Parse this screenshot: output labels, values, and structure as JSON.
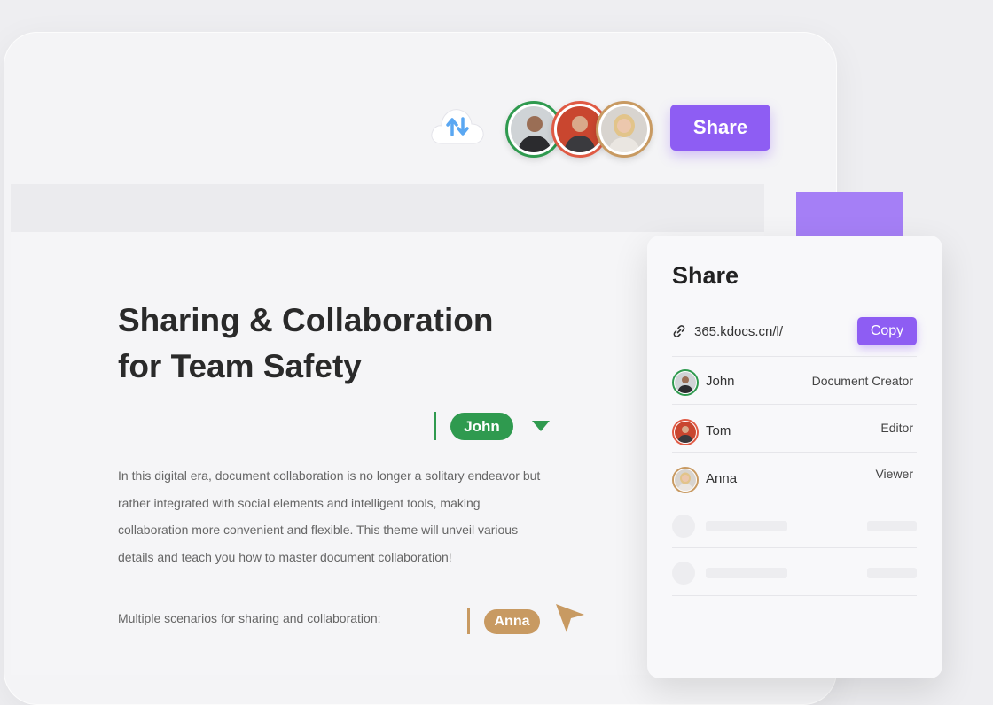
{
  "toolbar": {
    "share_label": "Share",
    "collaborators": [
      {
        "name": "John",
        "ring": "#2f9a4f"
      },
      {
        "name": "Tom",
        "ring": "#e05a44"
      },
      {
        "name": "Anna",
        "ring": "#c89a62"
      }
    ]
  },
  "document": {
    "title": "Sharing & Collaboration for Team Safety",
    "body": "In this digital era, document collaboration is no longer a solitary endeavor but rather integrated with social elements and intelligent tools, making collaboration more convenient and flexible. This theme will unveil various details and teach you how to master document collaboration!",
    "subheading": "Multiple scenarios for sharing and collaboration:"
  },
  "cursors": [
    {
      "name": "John",
      "color": "#2f9a4f"
    },
    {
      "name": "Anna",
      "color": "#c89a62"
    }
  ],
  "share_panel": {
    "title": "Share",
    "link": "365.kdocs.cn/l/",
    "copy_label": "Copy",
    "members": [
      {
        "name": "John",
        "role": "Document Creator",
        "ring": "#2f9a4f"
      },
      {
        "name": "Tom",
        "role": "Editor",
        "ring": "#e05a44"
      },
      {
        "name": "Anna",
        "role": "Viewer",
        "ring": "#c89a62"
      }
    ]
  },
  "colors": {
    "accent": "#8e5df3",
    "accent_light": "#a57ff6",
    "background": "#eeeef1"
  }
}
